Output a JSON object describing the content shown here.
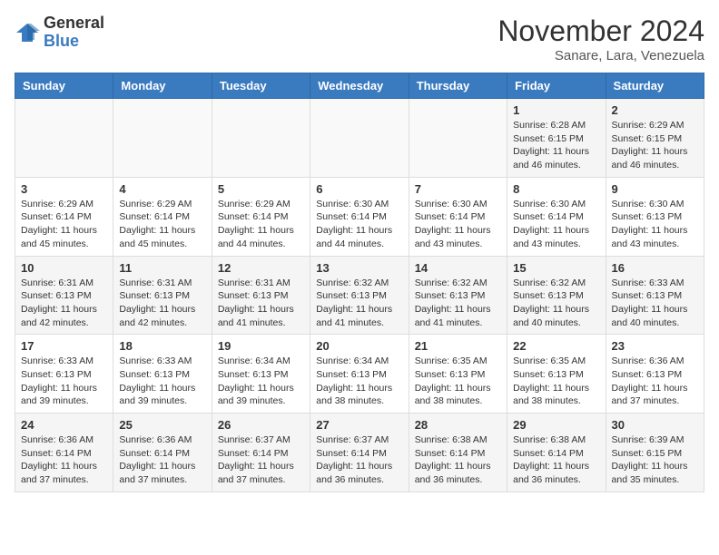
{
  "header": {
    "logo_general": "General",
    "logo_blue": "Blue",
    "month_year": "November 2024",
    "location": "Sanare, Lara, Venezuela"
  },
  "weekdays": [
    "Sunday",
    "Monday",
    "Tuesday",
    "Wednesday",
    "Thursday",
    "Friday",
    "Saturday"
  ],
  "weeks": [
    [
      {
        "day": "",
        "info": ""
      },
      {
        "day": "",
        "info": ""
      },
      {
        "day": "",
        "info": ""
      },
      {
        "day": "",
        "info": ""
      },
      {
        "day": "",
        "info": ""
      },
      {
        "day": "1",
        "info": "Sunrise: 6:28 AM\nSunset: 6:15 PM\nDaylight: 11 hours and 46 minutes."
      },
      {
        "day": "2",
        "info": "Sunrise: 6:29 AM\nSunset: 6:15 PM\nDaylight: 11 hours and 46 minutes."
      }
    ],
    [
      {
        "day": "3",
        "info": "Sunrise: 6:29 AM\nSunset: 6:14 PM\nDaylight: 11 hours and 45 minutes."
      },
      {
        "day": "4",
        "info": "Sunrise: 6:29 AM\nSunset: 6:14 PM\nDaylight: 11 hours and 45 minutes."
      },
      {
        "day": "5",
        "info": "Sunrise: 6:29 AM\nSunset: 6:14 PM\nDaylight: 11 hours and 44 minutes."
      },
      {
        "day": "6",
        "info": "Sunrise: 6:30 AM\nSunset: 6:14 PM\nDaylight: 11 hours and 44 minutes."
      },
      {
        "day": "7",
        "info": "Sunrise: 6:30 AM\nSunset: 6:14 PM\nDaylight: 11 hours and 43 minutes."
      },
      {
        "day": "8",
        "info": "Sunrise: 6:30 AM\nSunset: 6:14 PM\nDaylight: 11 hours and 43 minutes."
      },
      {
        "day": "9",
        "info": "Sunrise: 6:30 AM\nSunset: 6:13 PM\nDaylight: 11 hours and 43 minutes."
      }
    ],
    [
      {
        "day": "10",
        "info": "Sunrise: 6:31 AM\nSunset: 6:13 PM\nDaylight: 11 hours and 42 minutes."
      },
      {
        "day": "11",
        "info": "Sunrise: 6:31 AM\nSunset: 6:13 PM\nDaylight: 11 hours and 42 minutes."
      },
      {
        "day": "12",
        "info": "Sunrise: 6:31 AM\nSunset: 6:13 PM\nDaylight: 11 hours and 41 minutes."
      },
      {
        "day": "13",
        "info": "Sunrise: 6:32 AM\nSunset: 6:13 PM\nDaylight: 11 hours and 41 minutes."
      },
      {
        "day": "14",
        "info": "Sunrise: 6:32 AM\nSunset: 6:13 PM\nDaylight: 11 hours and 41 minutes."
      },
      {
        "day": "15",
        "info": "Sunrise: 6:32 AM\nSunset: 6:13 PM\nDaylight: 11 hours and 40 minutes."
      },
      {
        "day": "16",
        "info": "Sunrise: 6:33 AM\nSunset: 6:13 PM\nDaylight: 11 hours and 40 minutes."
      }
    ],
    [
      {
        "day": "17",
        "info": "Sunrise: 6:33 AM\nSunset: 6:13 PM\nDaylight: 11 hours and 39 minutes."
      },
      {
        "day": "18",
        "info": "Sunrise: 6:33 AM\nSunset: 6:13 PM\nDaylight: 11 hours and 39 minutes."
      },
      {
        "day": "19",
        "info": "Sunrise: 6:34 AM\nSunset: 6:13 PM\nDaylight: 11 hours and 39 minutes."
      },
      {
        "day": "20",
        "info": "Sunrise: 6:34 AM\nSunset: 6:13 PM\nDaylight: 11 hours and 38 minutes."
      },
      {
        "day": "21",
        "info": "Sunrise: 6:35 AM\nSunset: 6:13 PM\nDaylight: 11 hours and 38 minutes."
      },
      {
        "day": "22",
        "info": "Sunrise: 6:35 AM\nSunset: 6:13 PM\nDaylight: 11 hours and 38 minutes."
      },
      {
        "day": "23",
        "info": "Sunrise: 6:36 AM\nSunset: 6:13 PM\nDaylight: 11 hours and 37 minutes."
      }
    ],
    [
      {
        "day": "24",
        "info": "Sunrise: 6:36 AM\nSunset: 6:14 PM\nDaylight: 11 hours and 37 minutes."
      },
      {
        "day": "25",
        "info": "Sunrise: 6:36 AM\nSunset: 6:14 PM\nDaylight: 11 hours and 37 minutes."
      },
      {
        "day": "26",
        "info": "Sunrise: 6:37 AM\nSunset: 6:14 PM\nDaylight: 11 hours and 37 minutes."
      },
      {
        "day": "27",
        "info": "Sunrise: 6:37 AM\nSunset: 6:14 PM\nDaylight: 11 hours and 36 minutes."
      },
      {
        "day": "28",
        "info": "Sunrise: 6:38 AM\nSunset: 6:14 PM\nDaylight: 11 hours and 36 minutes."
      },
      {
        "day": "29",
        "info": "Sunrise: 6:38 AM\nSunset: 6:14 PM\nDaylight: 11 hours and 36 minutes."
      },
      {
        "day": "30",
        "info": "Sunrise: 6:39 AM\nSunset: 6:15 PM\nDaylight: 11 hours and 35 minutes."
      }
    ]
  ]
}
